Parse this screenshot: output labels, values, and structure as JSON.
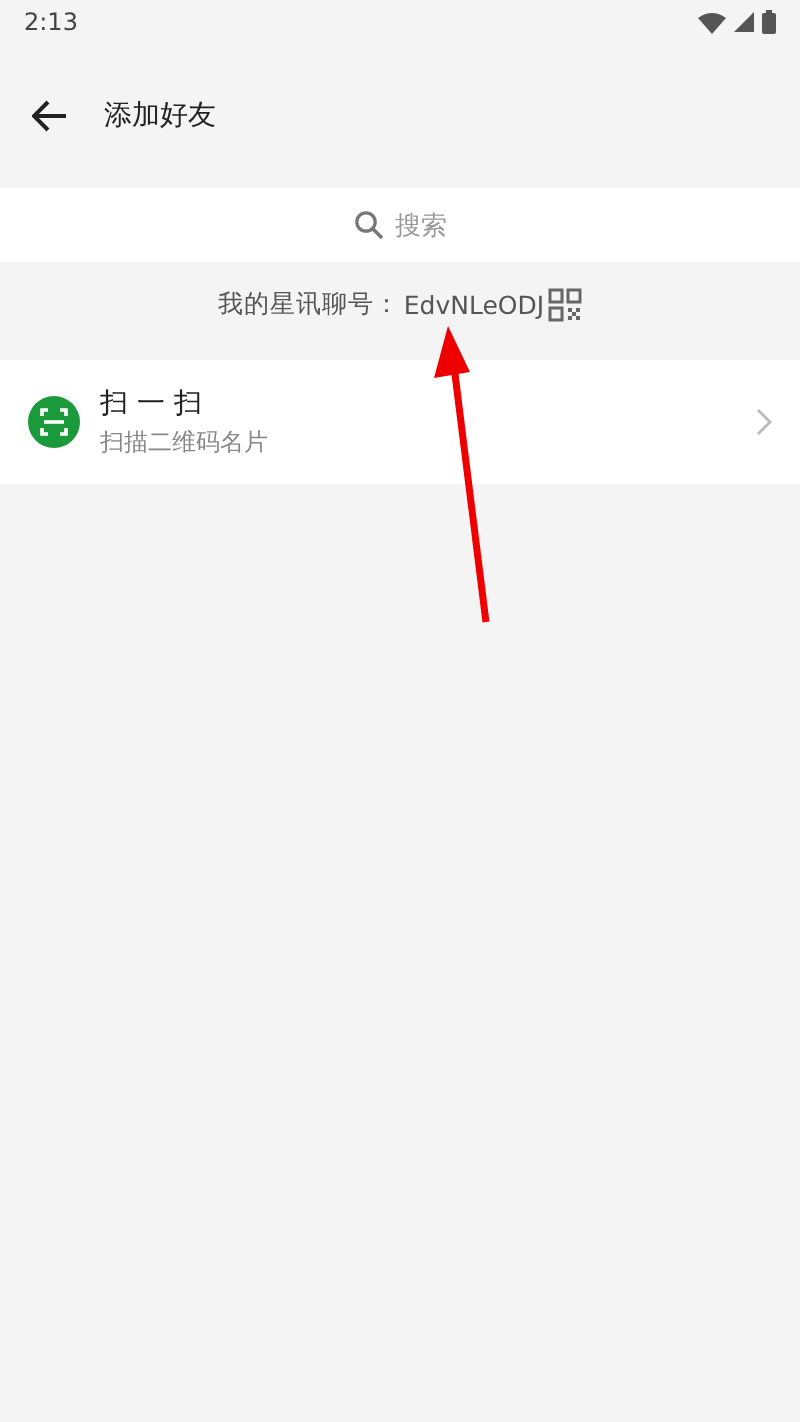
{
  "status_bar": {
    "time": "2:13"
  },
  "toolbar": {
    "title": "添加好友"
  },
  "search": {
    "placeholder": "搜索"
  },
  "my_id": {
    "label": "我的星讯聊号：",
    "value": "EdvNLeODJ"
  },
  "items": [
    {
      "title": "扫 一 扫",
      "subtitle": "扫描二维码名片"
    }
  ]
}
